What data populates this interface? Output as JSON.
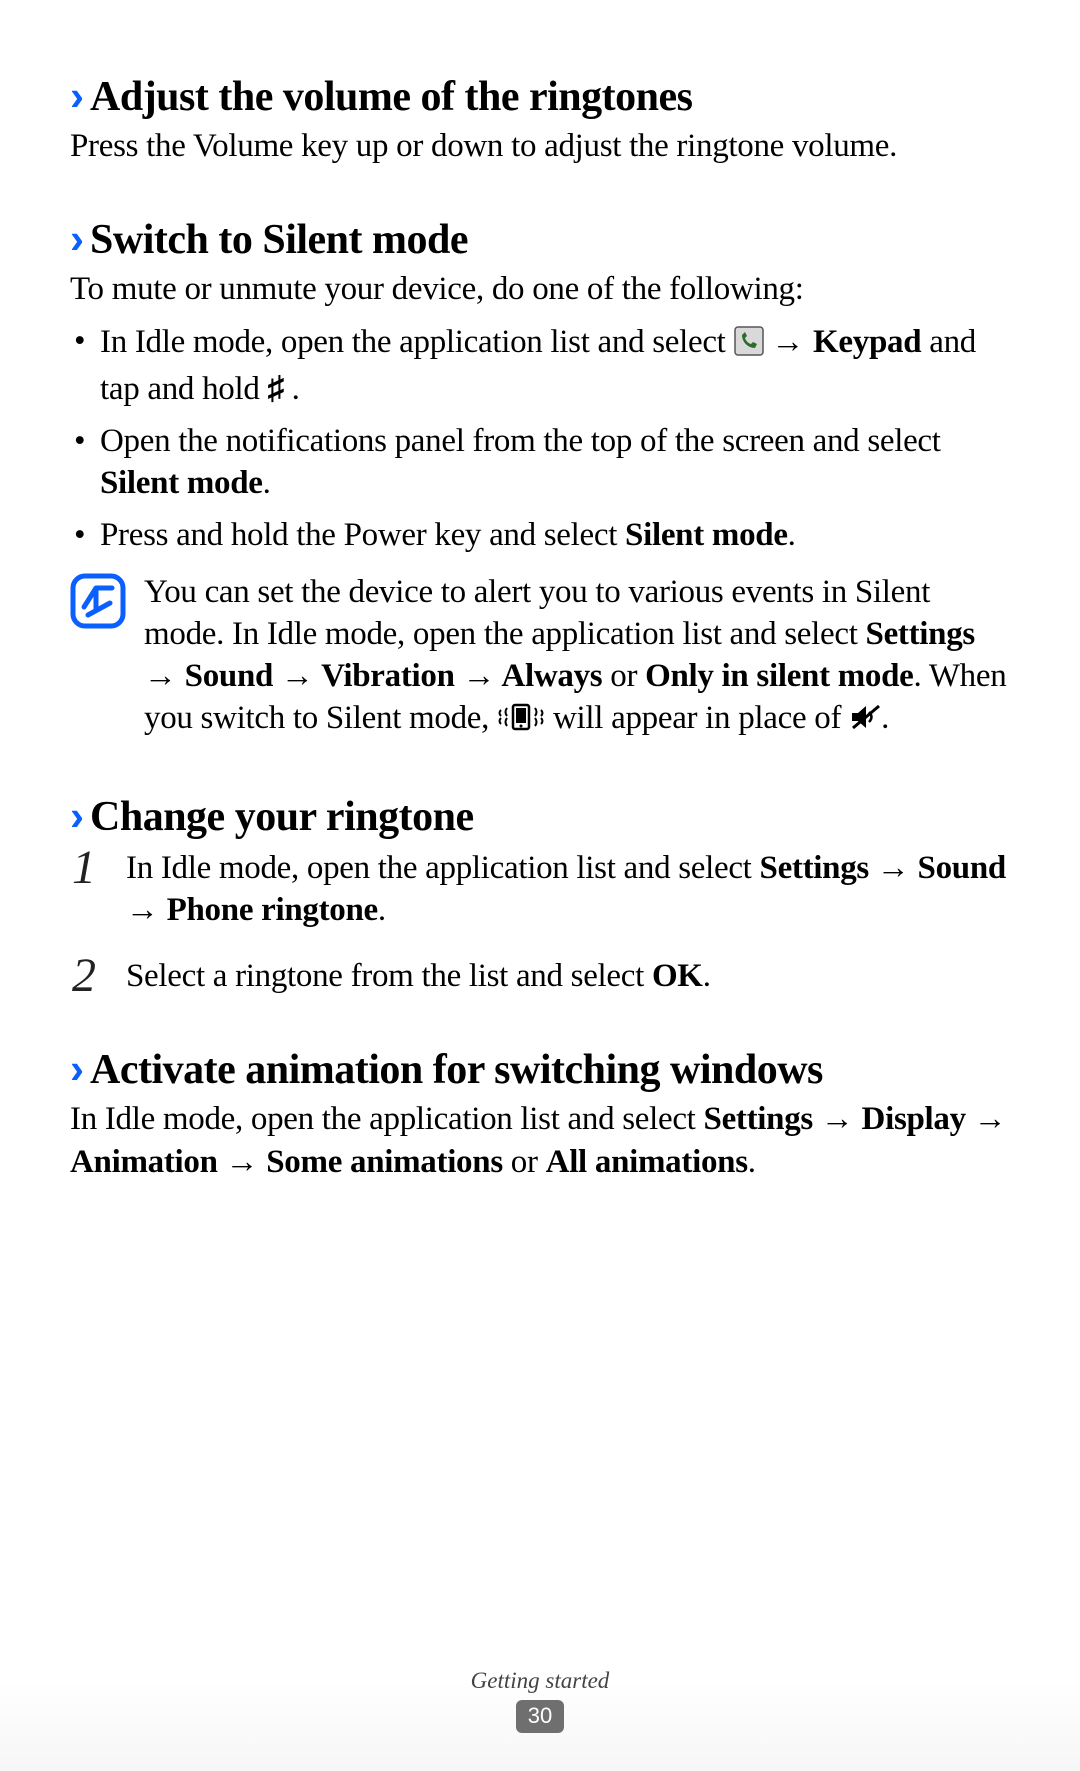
{
  "sections": {
    "volume": {
      "heading": "Adjust the volume of the ringtones",
      "body": "Press the Volume key up or down to adjust the ringtone volume."
    },
    "silent": {
      "heading": "Switch to Silent mode",
      "intro": "To mute or unmute your device, do one of the following:",
      "b1_a": "In Idle mode, open the application list and select ",
      "b1_b": " → ",
      "b1_c_bold": "Keypad",
      "b1_d": " and tap and hold ",
      "b1_e_bold": "♯",
      "b1_f": ".",
      "b2_a": "Open the notifications panel from the top of the screen and select ",
      "b2_b_bold": "Silent mode",
      "b2_c": ".",
      "b3_a": "Press and hold the Power key and select ",
      "b3_b_bold": "Silent mode",
      "b3_c": ".",
      "note_a": "You can set the device to alert you to various events in Silent mode. In Idle mode, open the application list and select ",
      "note_b_bold": "Settings → Sound → Vibration → Always",
      "note_c": " or ",
      "note_d_bold": "Only in silent mode",
      "note_e": ". When you switch to Silent mode, ",
      "note_f": " will appear in place of ",
      "note_g": "."
    },
    "ringtone": {
      "heading": "Change your ringtone",
      "s1_a": "In Idle mode, open the application list and select ",
      "s1_b_bold": "Settings → Sound → Phone ringtone",
      "s1_c": ".",
      "s2_a": "Select a ringtone from the list and select ",
      "s2_b_bold": "OK",
      "s2_c": "."
    },
    "animation": {
      "heading": "Activate animation for switching windows",
      "a": "In Idle mode, open the application list and select ",
      "b_bold": "Settings → Display → Animation → Some animations",
      "c": " or ",
      "d_bold": "All animations",
      "e": "."
    }
  },
  "footer": {
    "chapter": "Getting started",
    "page": "30"
  }
}
